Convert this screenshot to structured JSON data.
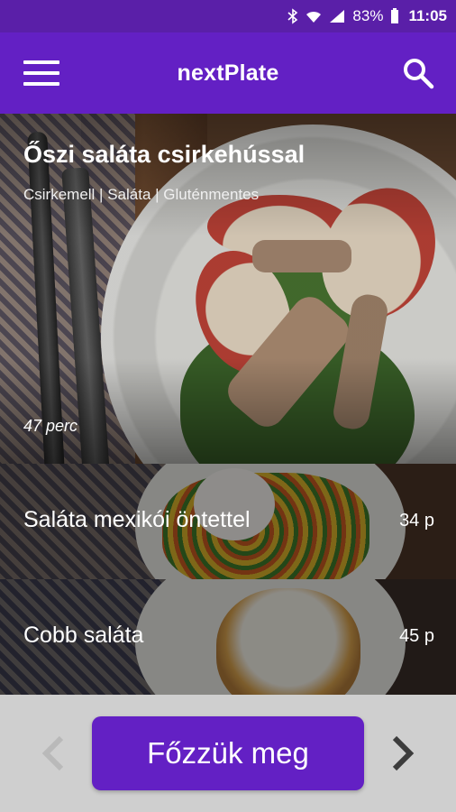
{
  "status_bar": {
    "battery": "83%",
    "time": "11:05",
    "icons": [
      "bluetooth-icon",
      "wifi-icon",
      "signal-icon",
      "battery-icon"
    ]
  },
  "app_bar": {
    "title": "nextPlate",
    "menu_icon": "menu-icon",
    "search_icon": "search-icon"
  },
  "hero": {
    "title": "Őszi saláta csirkehússal",
    "tags": "Csirkemell | Saláta | Gluténmentes",
    "time": "47 perc"
  },
  "recipes": [
    {
      "title": "Saláta mexikói öntettel",
      "time": "34 p"
    },
    {
      "title": "Cobb saláta",
      "time": "45 p"
    }
  ],
  "bottom": {
    "cook_label": "Főzzük meg",
    "prev_icon": "chevron-left-icon",
    "next_icon": "chevron-right-icon"
  },
  "colors": {
    "primary": "#6320c4",
    "status_bar": "#5a1fa8",
    "bottom_bg": "#cfcfcf"
  }
}
